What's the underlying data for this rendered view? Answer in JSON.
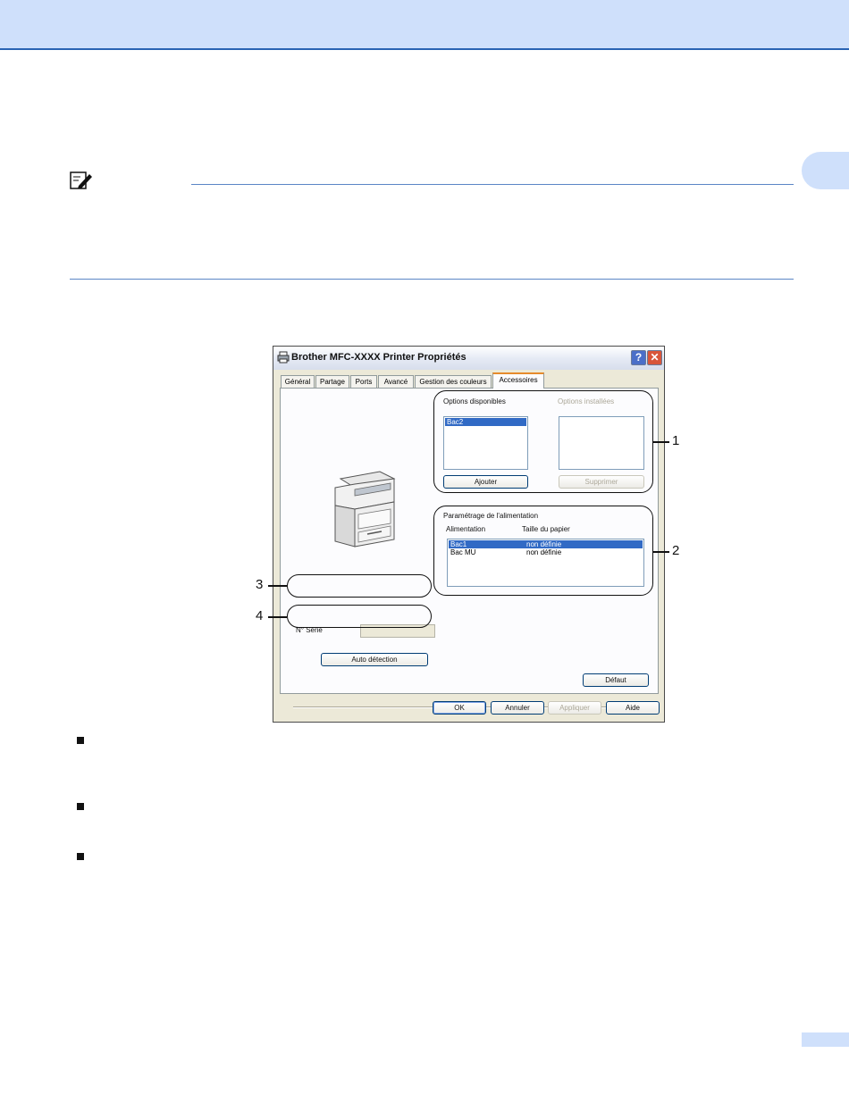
{
  "dialog": {
    "title": "Brother MFC-XXXX Printer Propriétés",
    "help_button": "?",
    "close_button": "✕",
    "tabs": [
      "Général",
      "Partage",
      "Ports",
      "Avancé",
      "Gestion des couleurs",
      "Accessoires"
    ],
    "active_tab": "Accessoires",
    "options": {
      "available_label": "Options disponibles",
      "available_items": [
        "Bac2"
      ],
      "installed_label": "Options installées",
      "installed_items": [],
      "add_button": "Ajouter",
      "remove_button": "Supprimer"
    },
    "source": {
      "group_label": "Paramétrage de l'alimentation",
      "col_source": "Alimentation",
      "col_size": "Taille du papier",
      "rows": [
        {
          "source": "Bac1",
          "size": "non définie"
        },
        {
          "source": "Bac MU",
          "size": "non définie"
        }
      ]
    },
    "serial_label": "N° Série",
    "serial_value": "",
    "auto_detect_button": "Auto détection",
    "default_button": "Défaut",
    "footer_buttons": {
      "ok": "OK",
      "cancel": "Annuler",
      "apply": "Appliquer",
      "help": "Aide"
    }
  },
  "callouts": [
    "1",
    "2",
    "3",
    "4"
  ],
  "icons": [
    "note-icon",
    "printer-icon",
    "mfc-illustration"
  ],
  "colors": {
    "header_band": "#cfe0fb",
    "header_rule": "#2a63b3",
    "selection": "#316ac5"
  }
}
